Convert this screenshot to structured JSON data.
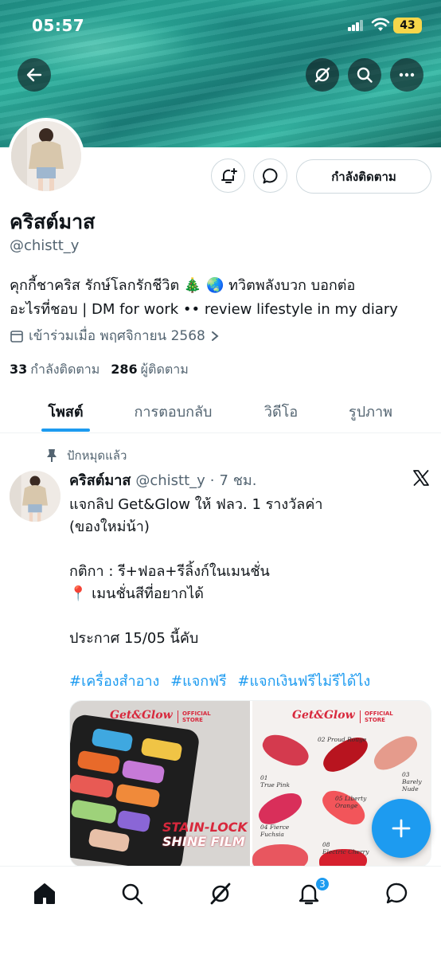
{
  "status_bar": {
    "time": "05:57",
    "battery": "43"
  },
  "profile": {
    "display_name": "คริสต์มาส",
    "handle": "@chistt_y",
    "follow_button": "กำลังติดตาม",
    "bio_line1": "คุกกี้ชาคริส รักษ์โลกรักชีวิต 🎄 🌏 ทวิตพลังบวก บอกต่อ",
    "bio_line2": "อะไรที่ชอบ | DM for work •• review lifestyle in my diary",
    "joined": "เข้าร่วมเมื่อ พฤศจิกายน 2568",
    "following_count": "33",
    "following_label": "กำลังติดตาม",
    "followers_count": "286",
    "followers_label": "ผู้ติดตาม"
  },
  "tabs": [
    {
      "label": "โพสต์",
      "active": true
    },
    {
      "label": "การตอบกลับ",
      "active": false
    },
    {
      "label": "วิดีโอ",
      "active": false
    },
    {
      "label": "รูปภาพ",
      "active": false
    }
  ],
  "post": {
    "pinned_label": "ปักหมุดแล้ว",
    "author_name": "คริสต์มาส",
    "author_handle": "@chistt_y",
    "separator": "·",
    "time": "7 ชม.",
    "line1": "แจกลิป Get&Glow ให้ ฟลว. 1 รางวัลค่า",
    "line2": "(ของใหม่น้า)",
    "line3": "กติกา : รี+ฟอล+รีลิ้งก์ในเมนชั่น",
    "line4": "📍 เมนชั่นสีที่อยากได้",
    "line5": "ประกาศ 15/05 นี้คับ",
    "hashtags": [
      "#เครื่องสำอาง",
      "#แจกฟรี",
      "#แจกเงินฟรีไม่รีได้ไง"
    ],
    "media": {
      "brand": "Get&Glow",
      "official_line1": "OFFICIAL",
      "official_line2": "STORE",
      "stain_line1": "STAIN-LOCK",
      "stain_line2": "SHINE FILM",
      "swatches": [
        {
          "num": "01",
          "name": "True Pink"
        },
        {
          "num": "02",
          "name": "Proud Rouge"
        },
        {
          "num": "03",
          "name": "Barely Nude"
        },
        {
          "num": "04",
          "name": "Fierce Fuchsia"
        },
        {
          "num": "05",
          "name": "Liberty Orange"
        },
        {
          "num": "08",
          "name": "Electric Cherry"
        }
      ]
    }
  },
  "nav": {
    "notification_badge": "3"
  },
  "colors": {
    "accent": "#1d9bf0",
    "text": "#0f1419",
    "secondary": "#536471",
    "brand_red": "#d8283c"
  }
}
